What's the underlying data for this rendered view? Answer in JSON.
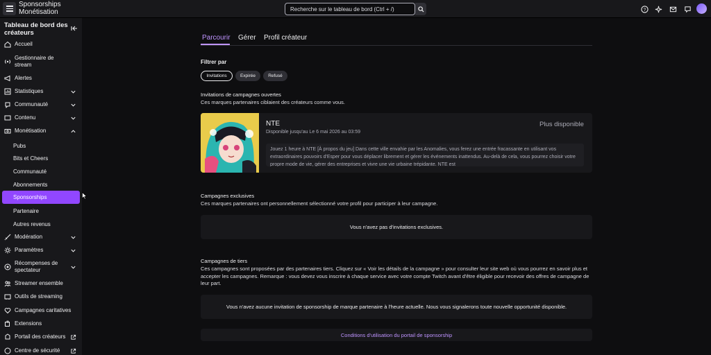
{
  "header": {
    "brand_line1": "Sponsorships",
    "brand_line2": "Monétisation",
    "search_placeholder": "Recherche sur le tableau de bord (Ctrl + /)"
  },
  "sidebar": {
    "title": "Tableau de bord des créateurs",
    "items": [
      {
        "label": "Accueil",
        "icon": "home-icon"
      },
      {
        "label": "Gestionnaire de stream",
        "icon": "broadcast-icon"
      },
      {
        "label": "Alertes",
        "icon": "megaphone-icon"
      },
      {
        "label": "Statistiques",
        "icon": "chart-icon"
      },
      {
        "label": "Communauté",
        "icon": "community-icon"
      },
      {
        "label": "Contenu",
        "icon": "content-icon"
      },
      {
        "label": "Monétisation",
        "icon": "money-icon"
      }
    ],
    "monetisation_sub": [
      "Pubs",
      "Bits et Cheers",
      "Communauté",
      "Abonnements",
      "Sponsorships",
      "Partenaire",
      "Autres revenus"
    ],
    "items_after": [
      {
        "label": "Modération",
        "icon": "sword-icon"
      },
      {
        "label": "Paramètres",
        "icon": "gear-icon"
      },
      {
        "label": "Récompenses de spectateur",
        "icon": "rewards-icon"
      },
      {
        "label": "Streamer ensemble",
        "icon": "collab-icon"
      },
      {
        "label": "Outils de streaming",
        "icon": "tools-icon"
      },
      {
        "label": "Campagnes caritatives",
        "icon": "charity-icon"
      },
      {
        "label": "Extensions",
        "icon": "extension-icon"
      },
      {
        "label": "Portail des créateurs",
        "icon": "portal-icon"
      },
      {
        "label": "Centre de sécurité",
        "icon": "safety-icon"
      }
    ]
  },
  "tabs": [
    "Parcourir",
    "Gérer",
    "Profil créateur"
  ],
  "filter": {
    "label": "Filtrer par",
    "chips": [
      "Invitations",
      "Expirée",
      "Refusé"
    ]
  },
  "open_invites": {
    "title": "Invitations de campagnes ouvertes",
    "desc": "Ces marques partenaires ciblaient des créateurs comme vous.",
    "card": {
      "title": "NTE",
      "available": "Disponible jusqu'au Le 6 mai 2026 au 03:59",
      "status": "Plus disponible",
      "description": "Jouez 1 heure à NTE [À propos du jeu] Dans cette ville envahie par les Anomalies, vous ferez une entrée fracassante en utilisant vos extraordinaires pouvoirs d'Esper pour vous déplacer librement et gérer les événements inattendus. Au-delà de cela, vous pourrez choisir votre propre mode de vie, gérer des entreprises et vivre une vie urbaine trépidante. NTE est"
    }
  },
  "exclusive": {
    "title": "Campagnes exclusives",
    "desc": "Ces marques partenaires ont personnellement sélectionné votre profil pour participer à leur campagne.",
    "empty": "Vous n'avez pas d'invitations exclusives."
  },
  "third_party": {
    "title": "Campagnes de tiers",
    "desc": "Ces campagnes sont proposées par des partenaires tiers. Cliquez sur « Voir les détails de la campagne » pour consulter leur site web où vous pourrez en savoir plus et accepter les campagnes. Remarque : vous devez vous inscrire à chaque service avec votre compte Twitch avant d'être éligible pour recevoir des offres de campagne de leur part.",
    "empty": "Vous n'avez aucune invitation de sponsorship de marque partenaire à l'heure actuelle. Nous vous signalerons toute nouvelle opportunité disponible."
  },
  "terms_link": "Conditions d'utilisation du portail de sponsorship",
  "colors": {
    "accent": "#9147ff",
    "accent_light": "#bf94ff",
    "bg": "#0e0e10",
    "panel": "#18181b"
  }
}
